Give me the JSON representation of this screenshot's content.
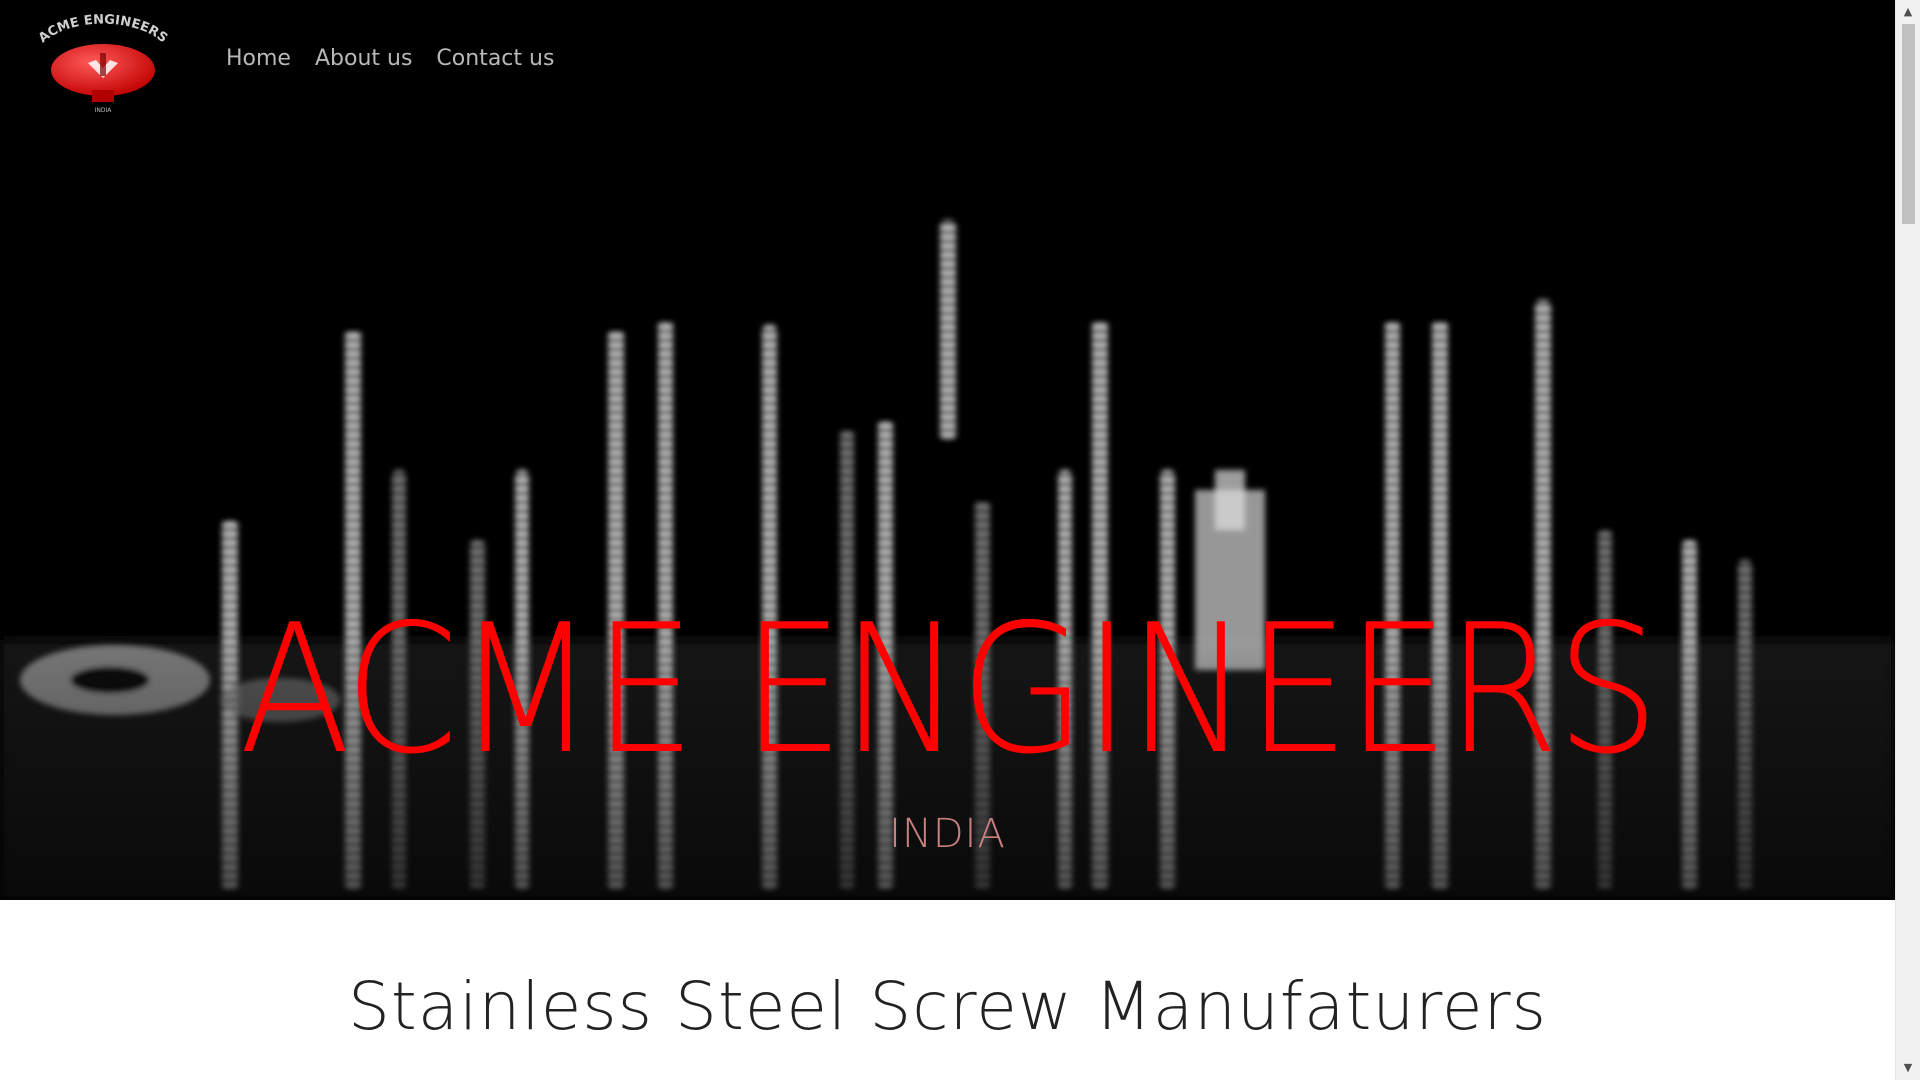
{
  "brand": {
    "logo_ring_text": "ACME ENGINEERS",
    "logo_sub_text": "INDIA"
  },
  "nav": {
    "items": [
      {
        "label": "Home"
      },
      {
        "label": "About us"
      },
      {
        "label": "Contact us"
      }
    ]
  },
  "hero": {
    "title": "ACME ENGINEERS",
    "subtitle": "INDIA",
    "title_color": "#ff0000",
    "background": "#000000"
  },
  "main": {
    "headline": "Stainless Steel Screw Manufaturers"
  },
  "scrollbar": {
    "up_icon": "arrow-up-icon",
    "down_icon": "arrow-down-icon"
  }
}
